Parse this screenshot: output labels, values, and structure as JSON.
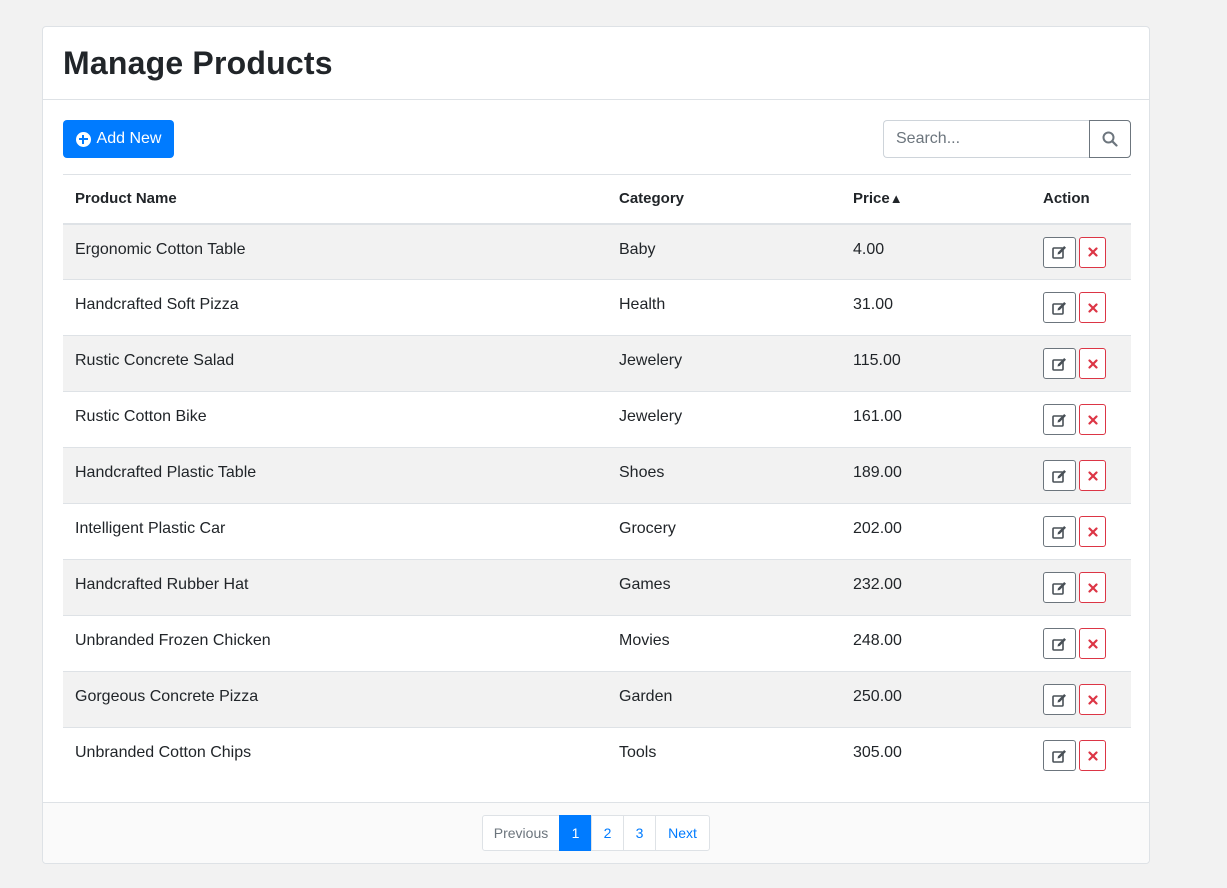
{
  "page": {
    "title": "Manage Products"
  },
  "toolbar": {
    "add_label": "Add New",
    "search_placeholder": "Search..."
  },
  "table": {
    "headers": {
      "name": "Product Name",
      "category": "Category",
      "price": "Price",
      "price_sort": "▲",
      "action": "Action"
    },
    "rows": [
      {
        "name": "Ergonomic Cotton Table",
        "category": "Baby",
        "price": "4.00"
      },
      {
        "name": "Handcrafted Soft Pizza",
        "category": "Health",
        "price": "31.00"
      },
      {
        "name": "Rustic Concrete Salad",
        "category": "Jewelery",
        "price": "115.00"
      },
      {
        "name": "Rustic Cotton Bike",
        "category": "Jewelery",
        "price": "161.00"
      },
      {
        "name": "Handcrafted Plastic Table",
        "category": "Shoes",
        "price": "189.00"
      },
      {
        "name": "Intelligent Plastic Car",
        "category": "Grocery",
        "price": "202.00"
      },
      {
        "name": "Handcrafted Rubber Hat",
        "category": "Games",
        "price": "232.00"
      },
      {
        "name": "Unbranded Frozen Chicken",
        "category": "Movies",
        "price": "248.00"
      },
      {
        "name": "Gorgeous Concrete Pizza",
        "category": "Garden",
        "price": "250.00"
      },
      {
        "name": "Unbranded Cotton Chips",
        "category": "Tools",
        "price": "305.00"
      }
    ]
  },
  "pagination": {
    "previous": "Previous",
    "pages": [
      "1",
      "2",
      "3"
    ],
    "active": "1",
    "next": "Next"
  },
  "colors": {
    "primary": "#007bff",
    "danger": "#dc3545",
    "secondary": "#6c757d"
  },
  "icons": {
    "add": "plus-circle-icon",
    "search": "search-icon",
    "edit": "edit-icon",
    "delete": "close-icon"
  }
}
